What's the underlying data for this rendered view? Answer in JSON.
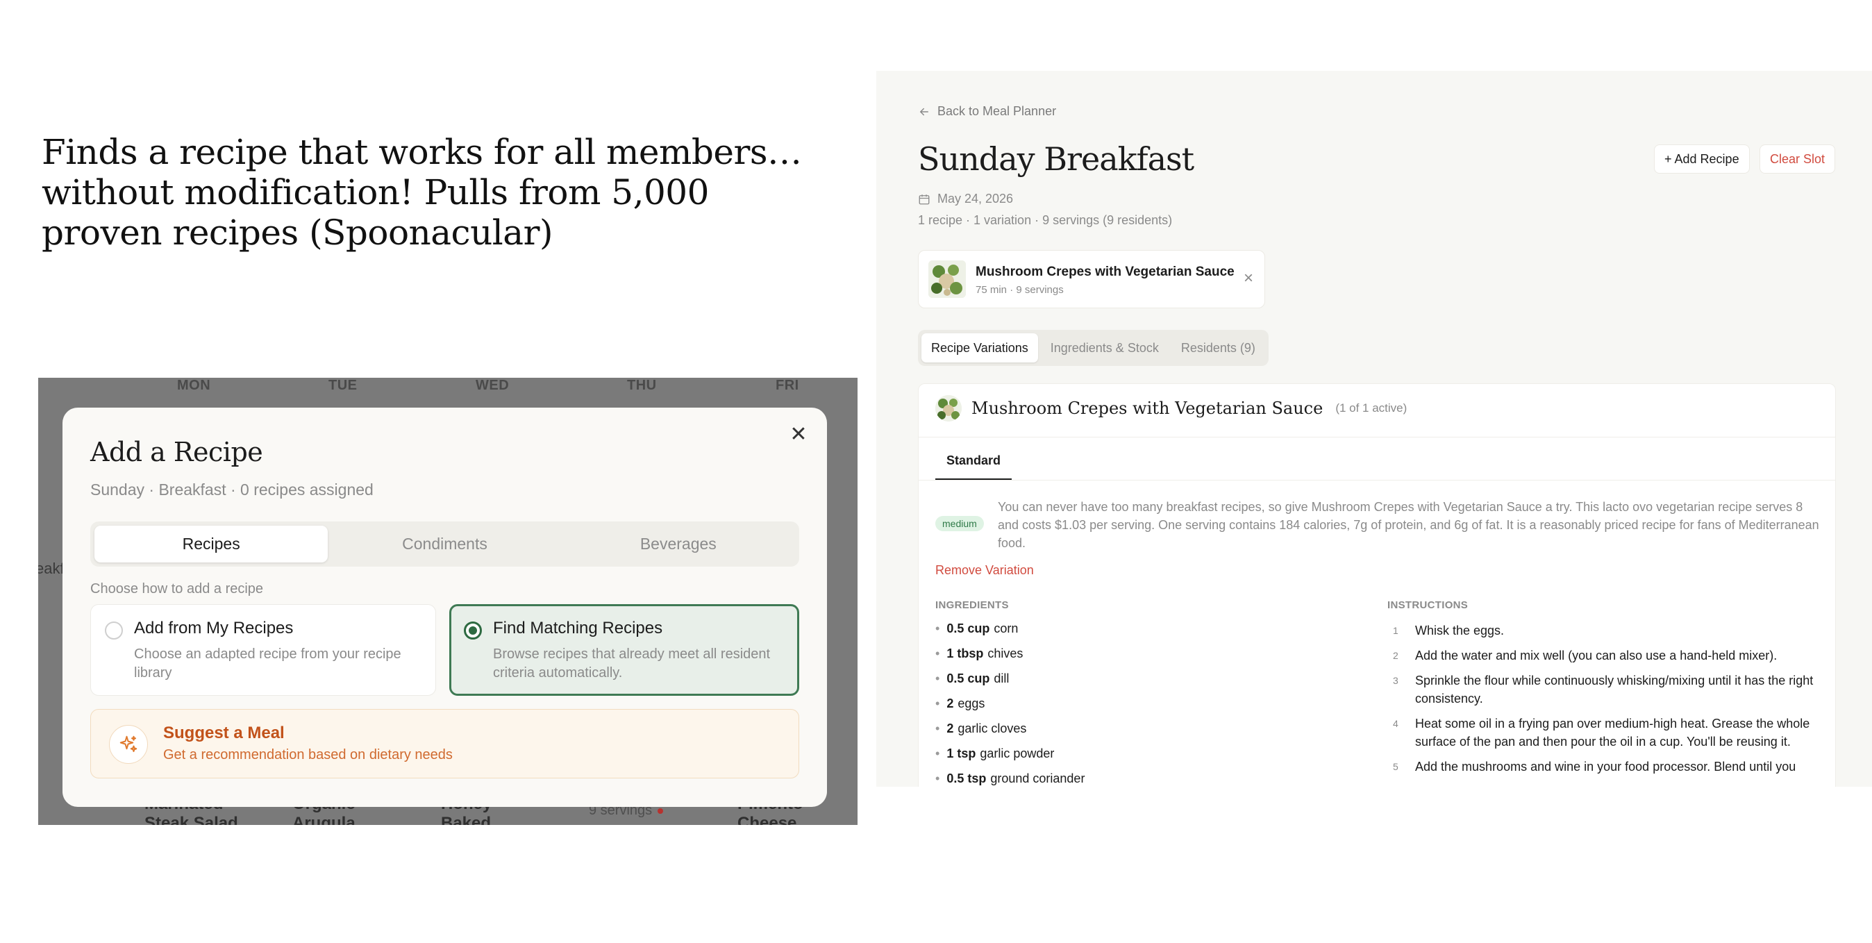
{
  "headline": "Finds a recipe that works for all members…without modification! Pulls from 5,000 proven recipes (Spoonacular)",
  "planner_background": {
    "days": [
      "MON",
      "TUE",
      "WED",
      "THU",
      "FRI"
    ],
    "side_text": "eakf",
    "cells": [
      "Marinated Steak Salad",
      "Organic Arugula",
      "Honey-Baked Ham",
      "Pimento Cheese"
    ],
    "servings": "9 servings"
  },
  "modal": {
    "title": "Add a Recipe",
    "subtitle": "Sunday · Breakfast · 0 recipes assigned",
    "close_icon": "✕",
    "tabs": [
      "Recipes",
      "Condiments",
      "Beverages"
    ],
    "active_tab": "Recipes",
    "choose_label": "Choose how to add a recipe",
    "options": [
      {
        "title": "Add from My Recipes",
        "desc": "Choose an adapted recipe from your recipe library",
        "selected": false
      },
      {
        "title": "Find Matching Recipes",
        "desc": "Browse recipes that already meet all resident criteria automatically.",
        "selected": true
      }
    ],
    "suggest": {
      "title": "Suggest a Meal",
      "desc": "Get a recommendation based on dietary needs",
      "icon": "sparkle-icon"
    },
    "accent_color": "#2d6a41",
    "suggest_color": "#c2521a"
  },
  "detail": {
    "back_label": "Back to Meal Planner",
    "title": "Sunday Breakfast",
    "add_recipe_label": "+ Add Recipe",
    "clear_slot_label": "Clear Slot",
    "date": "May 24, 2026",
    "meta": "1 recipe · 1 variation · 9 servings (9 residents)",
    "chip": {
      "title": "Mushroom Crepes with Vegetarian Sauce",
      "meta": "75 min · 9 servings"
    },
    "tabs": [
      "Recipe Variations",
      "Ingredients & Stock",
      "Residents (9)"
    ],
    "active_tab": "Recipe Variations",
    "panel": {
      "title": "Mushroom Crepes with Vegetarian Sauce",
      "count": "(1 of 1 active)",
      "variant_tab": "Standard",
      "difficulty": "medium",
      "description": "You can never have too many breakfast recipes, so give Mushroom Crepes with Vegetarian Sauce a try. This lacto ovo vegetarian recipe serves 8 and costs $1.03 per serving. One serving contains 184 calories, 7g of protein, and 6g of fat. It is a reasonably priced recipe for fans of Mediterranean food.",
      "remove_label": "Remove Variation",
      "ingredients_head": "INGREDIENTS",
      "instructions_head": "INSTRUCTIONS",
      "ingredients": [
        {
          "qty": "0.5 cup",
          "name": "corn"
        },
        {
          "qty": "1 tbsp",
          "name": "chives"
        },
        {
          "qty": "0.5 cup",
          "name": "dill"
        },
        {
          "qty": "2",
          "name": "eggs"
        },
        {
          "qty": "2",
          "name": "garlic cloves"
        },
        {
          "qty": "1 tsp",
          "name": "garlic powder"
        },
        {
          "qty": "0.5 tsp",
          "name": "ground coriander"
        }
      ],
      "instructions": [
        {
          "n": "1",
          "text": "Whisk the eggs."
        },
        {
          "n": "2",
          "text": "Add the water and mix well (you can also use a hand-held mixer)."
        },
        {
          "n": "3",
          "text": "Sprinkle the flour while continuously whisking/mixing until it has the right consistency."
        },
        {
          "n": "4",
          "text": "Heat some oil in a frying pan over medium-high heat. Grease the whole surface of the pan and then pour the oil in a cup. You'll be reusing it."
        },
        {
          "n": "5",
          "text": "Add the mushrooms and wine in your food processor. Blend until you"
        }
      ]
    },
    "danger_color": "#d14b3f"
  }
}
